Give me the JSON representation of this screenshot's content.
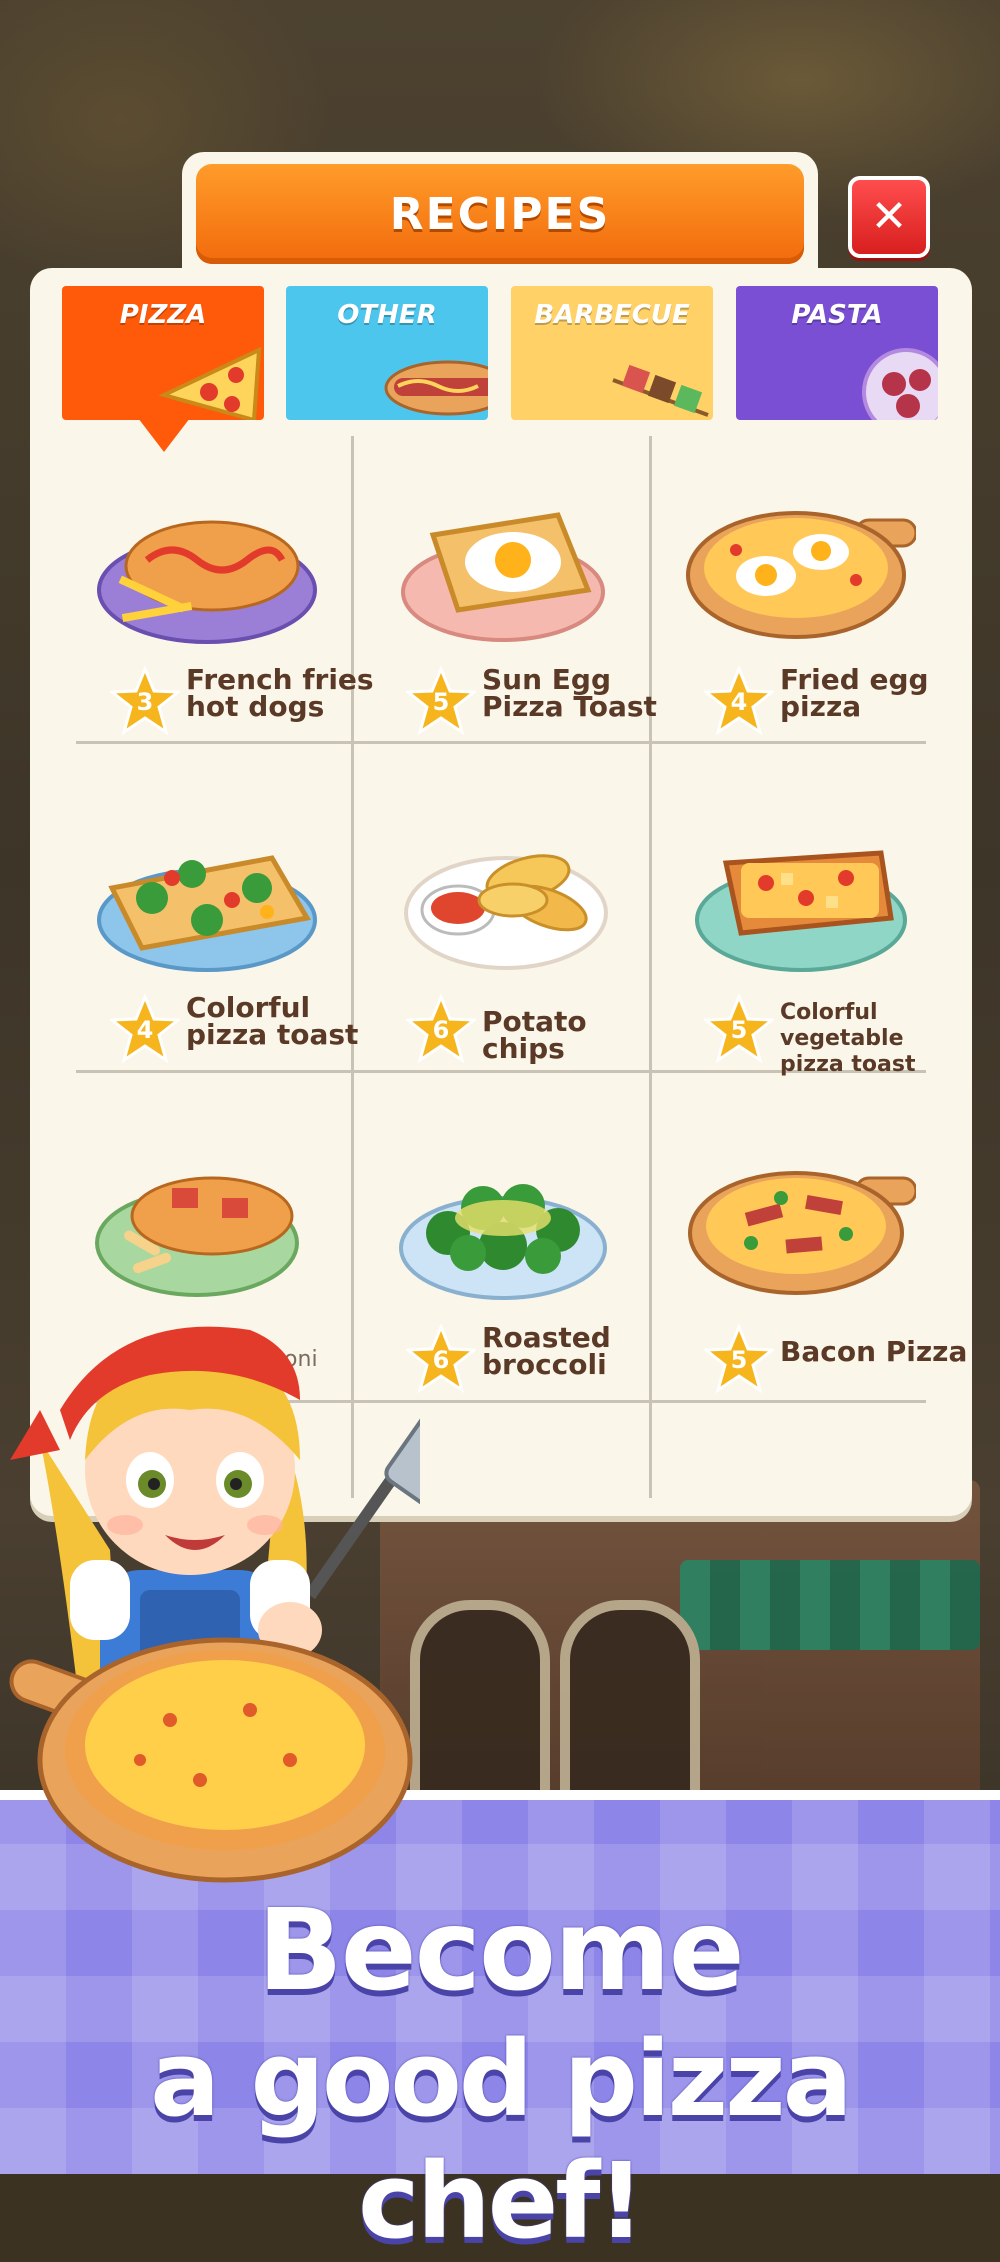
{
  "header": {
    "title": "RECIPES"
  },
  "close_button": {
    "icon": "close-icon",
    "symbol": "✕"
  },
  "tabs": [
    {
      "label": "PIZZA",
      "color": "#ff5a0a",
      "selected": true
    },
    {
      "label": "OTHER",
      "color": "#4dc6ee",
      "selected": false
    },
    {
      "label": "BARBECUE",
      "color": "#ffd166",
      "selected": false
    },
    {
      "label": "PASTA",
      "color": "#7a4fd4",
      "selected": false
    }
  ],
  "recipes": [
    {
      "level": "3",
      "name": "French fries hot dogs",
      "line1": "French fries",
      "line2": "hot dogs"
    },
    {
      "level": "5",
      "name": "Sun Egg Pizza Toast",
      "line1": "Sun Egg",
      "line2": "Pizza Toast"
    },
    {
      "level": "4",
      "name": "Fried egg pizza",
      "line1": "Fried egg",
      "line2": "pizza"
    },
    {
      "level": "4",
      "name": "Colorful pizza toast",
      "line1": "Colorful",
      "line2": "pizza toast"
    },
    {
      "level": "6",
      "name": "Potato chips",
      "line1": "Potato chips",
      "line2": ""
    },
    {
      "level": "5",
      "name": "Colorful vegetable pizza toast",
      "line1": "Colorful vegetable",
      "line2": "pizza toast"
    },
    {
      "level": "",
      "name": "aroni",
      "line1": "aroni",
      "line2": ""
    },
    {
      "level": "6",
      "name": "Roasted broccoli",
      "line1": "Roasted",
      "line2": "broccoli"
    },
    {
      "level": "5",
      "name": "Bacon Pizza",
      "line1": "Bacon Pizza",
      "line2": ""
    }
  ],
  "banner": {
    "line1": "Become",
    "line2": "a good pizza chef!"
  }
}
